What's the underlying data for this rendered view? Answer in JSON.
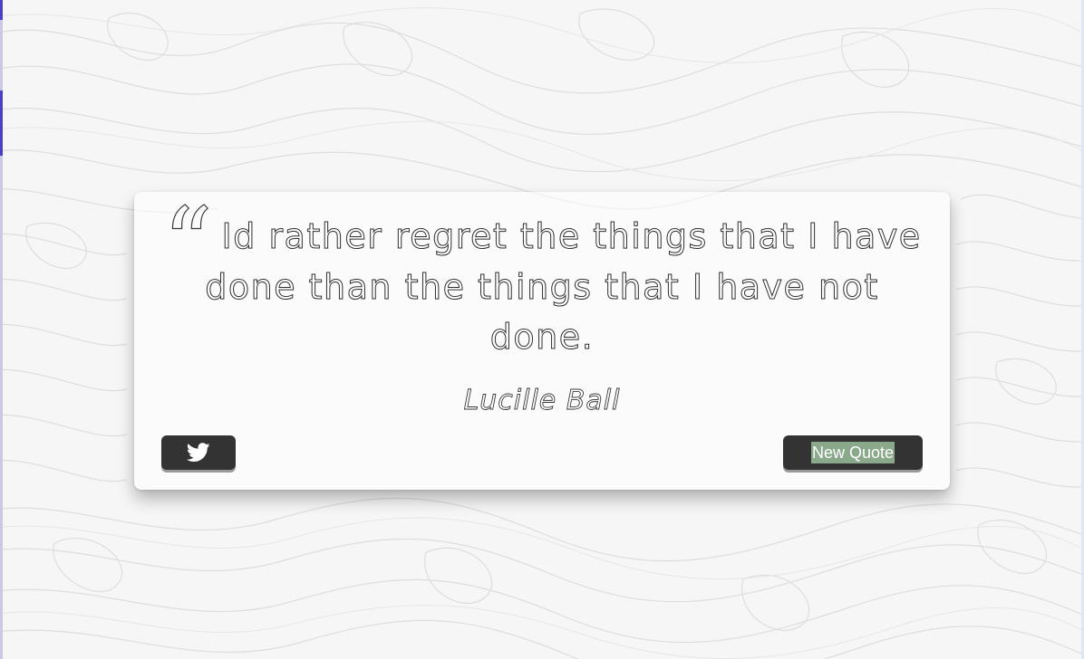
{
  "quote": {
    "text": "Id rather regret the things that I have done than the things that I have not done.",
    "author": "Lucille Ball"
  },
  "buttons": {
    "tweet_icon": "twitter-icon",
    "new_quote_label": "New Quote"
  },
  "colors": {
    "button_bg": "#333333",
    "selection_highlight": "#8aa88a",
    "background": "#f6f6f6"
  }
}
